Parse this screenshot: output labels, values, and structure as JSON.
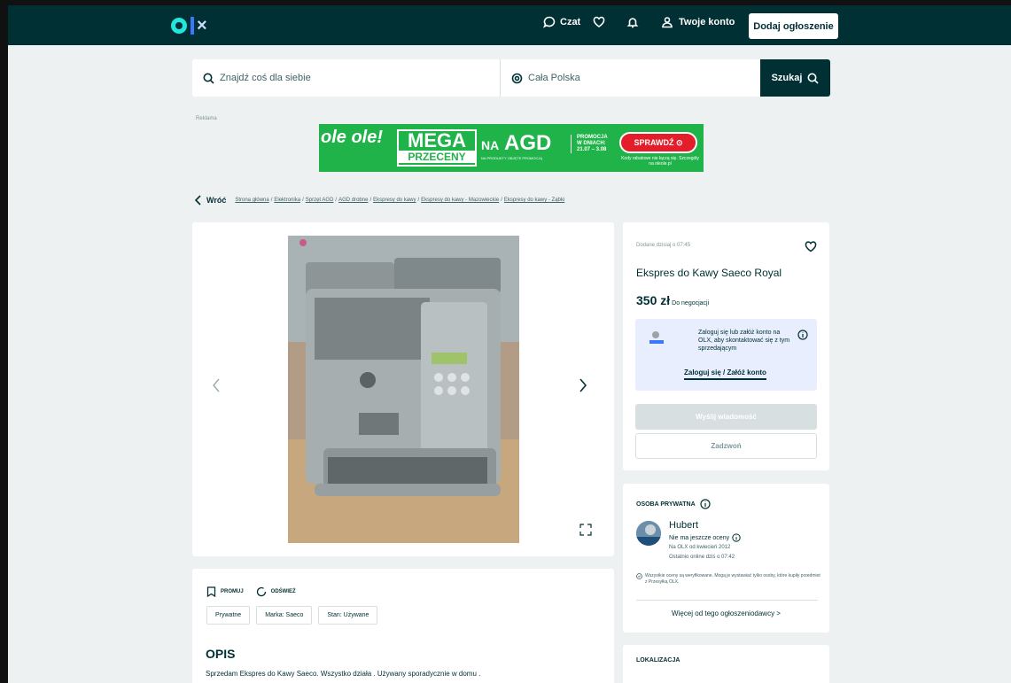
{
  "header": {
    "nav": {
      "chat": "Czat",
      "account": "Twoje konto"
    },
    "add_button": "Dodaj ogłoszenie"
  },
  "search": {
    "query_placeholder": "Znajdź coś dla siebie",
    "location": "Cała Polska",
    "button": "Szukaj"
  },
  "ad": {
    "label": "Reklama",
    "brand": "ole ole!",
    "mega_line1": "MEGA",
    "mega_line2": "PRZECENY",
    "na": "NA",
    "agd": "AGD",
    "sub": "NA PRODUKTY OBJĘTE PROMOCJĄ",
    "promo_line1": "PROMOCJA",
    "promo_line2": "W DNIACH:",
    "promo_line3": "21.07 – 3.08",
    "cta": "SPRAWDŹ ⊙",
    "note": "Kody rabatowe nie łączą się. Szczegóły na oleole.pl"
  },
  "breadcrumb": {
    "back": "Wróć",
    "items": [
      "Strona główna",
      "Elektronika",
      "Sprzęt AGD",
      "AGD drobne",
      "Ekspresy do kawy",
      "Ekspresy do kawy - Mazowieckie",
      "Ekspresy do kawy - Ząbki"
    ]
  },
  "listing": {
    "added": "Dodane dzisiaj o 07:45",
    "title": "Ekspres do Kawy Saeco Royal",
    "price": "350 zł",
    "negotiable": "Do negocjacji",
    "login_text": "Zaloguj się lub załóż konto na OLX, aby skontaktować się z tym sprzedającym",
    "login_link": "Zaloguj się / Załóż konto",
    "message_button": "Wyślij wiadomość",
    "call_button": "Zadzwoń",
    "promote": "PROMUJ",
    "refresh": "ODŚWIEŻ",
    "tags": [
      "Prywatne",
      "Marka: Saeco",
      "Stan: Używane"
    ],
    "description_heading": "OPIS",
    "description": "Sprzedam Ekspres do Kawy Saeco. Wszystko działa . Używany sporadycznie w domu ."
  },
  "seller": {
    "type": "OSOBA PRYWATNA",
    "name": "Hubert",
    "rating": "Nie ma jeszcze oceny",
    "since": "Na OLX od kwiecień 2012",
    "online": "Ostatnio online dziś o 07:42",
    "verify_note": "Wszystkie oceny są weryfikowane. Mogą je wystawiać tylko osoby, które kupiły przedmiot z Przesyłką OLX.",
    "more_link": "Więcej od tego ogłoszeniodawcy >"
  },
  "location_heading": "LOKALIZACJA",
  "colors": {
    "brand_dark": "#002f34",
    "accent_teal": "#23e5db",
    "ad_green": "#20b34a"
  }
}
